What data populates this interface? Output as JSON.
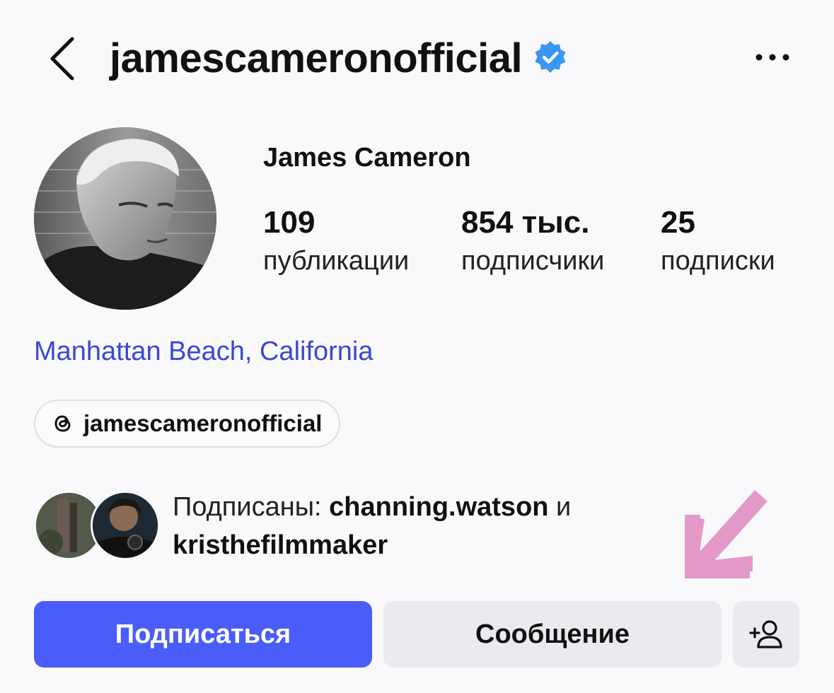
{
  "header": {
    "username": "jamescameronofficial",
    "back_icon": "chevron-left-icon",
    "verified_icon": "verified-badge-icon",
    "more_icon": "more-horizontal-icon"
  },
  "profile": {
    "full_name": "James Cameron",
    "stats": [
      {
        "value": "109",
        "label": "публикации"
      },
      {
        "value": "854 тыс.",
        "label": "подписчики"
      },
      {
        "value": "25",
        "label": "подписки"
      }
    ],
    "location": "Manhattan Beach, California",
    "threads_handle": "jamescameronofficial"
  },
  "mutual": {
    "prefix": "Подписаны: ",
    "user1": "channing.watson",
    "joiner": " и",
    "user2": "kristhefilmmaker"
  },
  "actions": {
    "follow_label": "Подписаться",
    "message_label": "Сообщение",
    "add_user_icon": "add-person-icon"
  },
  "colors": {
    "accent": "#4a5df9",
    "location_link": "#3a49d1",
    "verified": "#3897f0",
    "arrow": "#e39ac8"
  }
}
